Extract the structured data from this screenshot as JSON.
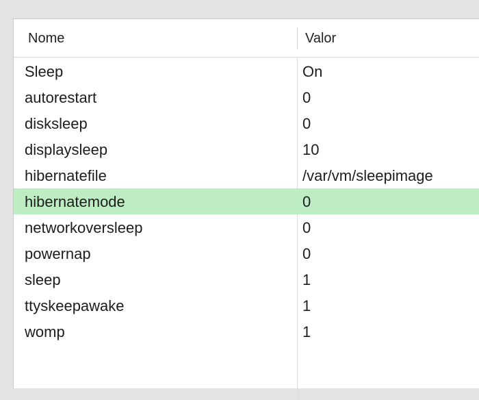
{
  "table": {
    "columns": {
      "name": "Nome",
      "value": "Valor"
    },
    "rows": [
      {
        "name": "Sleep",
        "value": "On",
        "selected": false
      },
      {
        "name": "autorestart",
        "value": "0",
        "selected": false
      },
      {
        "name": "disksleep",
        "value": "0",
        "selected": false
      },
      {
        "name": "displaysleep",
        "value": "10",
        "selected": false
      },
      {
        "name": "hibernatefile",
        "value": "/var/vm/sleepimage",
        "selected": false
      },
      {
        "name": "hibernatemode",
        "value": "0",
        "selected": true
      },
      {
        "name": "networkoversleep",
        "value": "0",
        "selected": false
      },
      {
        "name": "powernap",
        "value": "0",
        "selected": false
      },
      {
        "name": "sleep",
        "value": "1",
        "selected": false
      },
      {
        "name": "ttyskeepawake",
        "value": "1",
        "selected": false
      },
      {
        "name": "womp",
        "value": "1",
        "selected": false
      }
    ],
    "selected_row_color": "#bfedc3"
  }
}
